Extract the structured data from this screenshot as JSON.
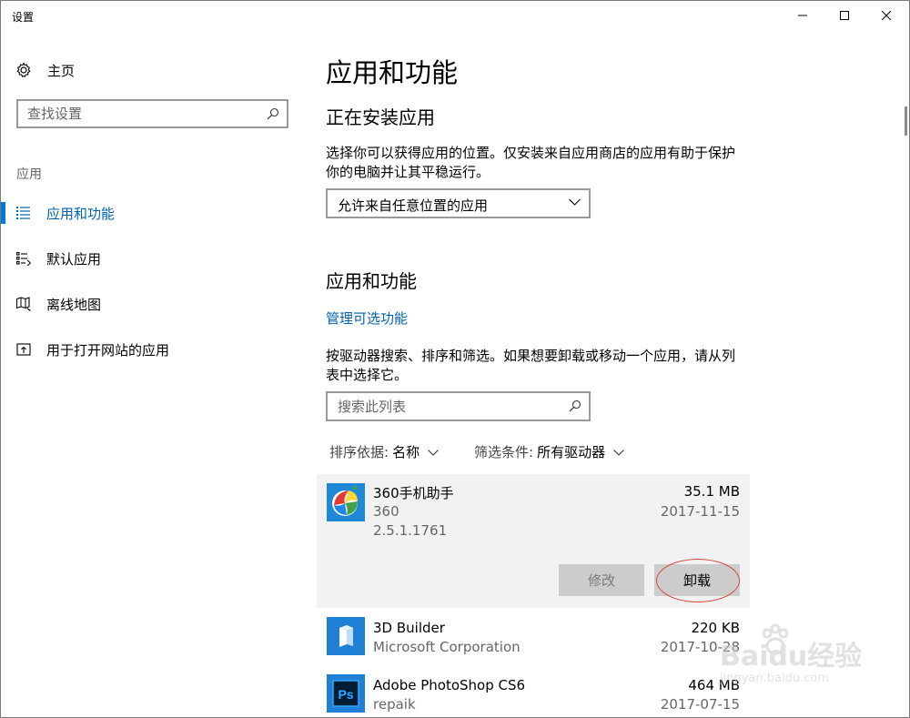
{
  "window": {
    "title": "设置"
  },
  "sidebar": {
    "home_label": "主页",
    "search_placeholder": "查找设置",
    "section_label": "应用",
    "items": [
      {
        "label": "应用和功能",
        "icon": "list-icon",
        "active": true
      },
      {
        "label": "默认应用",
        "icon": "default-apps-icon",
        "active": false
      },
      {
        "label": "离线地图",
        "icon": "map-icon",
        "active": false
      },
      {
        "label": "用于打开网站的应用",
        "icon": "website-app-icon",
        "active": false
      }
    ]
  },
  "main": {
    "title": "应用和功能",
    "install_section": {
      "heading": "正在安装应用",
      "description": "选择你可以获得应用的位置。仅安装来自应用商店的应用有助于保护你的电脑并让其平稳运行。",
      "dropdown_value": "允许来自任意位置的应用"
    },
    "apps_section": {
      "heading": "应用和功能",
      "manage_link": "管理可选功能",
      "description": "按驱动器搜索、排序和筛选。如果想要卸载或移动一个应用，请从列表中选择它。",
      "search_placeholder": "搜索此列表",
      "sort_label": "排序依据:",
      "sort_value": "名称",
      "filter_label": "筛选条件:",
      "filter_value": "所有驱动器"
    },
    "apps": [
      {
        "name": "360手机助手",
        "publisher": "360",
        "version": "2.5.1.1761",
        "size": "35.1 MB",
        "date": "2017-11-15",
        "selected": true
      },
      {
        "name": "3D Builder",
        "publisher": "Microsoft Corporation",
        "size": "220 KB",
        "date": "2017-10-28"
      },
      {
        "name": "Adobe PhotoShop CS6",
        "publisher": "repaik",
        "size": "464 MB",
        "date": "2017-07-15"
      }
    ],
    "buttons": {
      "modify": "修改",
      "uninstall": "卸载"
    }
  },
  "watermark": {
    "text": "Baidu经验",
    "sub": "jingyan.baidu.com"
  },
  "colors": {
    "accent": "#0078d7",
    "link": "#0063b1",
    "selected_bg": "#f2f2f2",
    "button_bg": "#cccccc",
    "annotation": "#d9453d"
  }
}
